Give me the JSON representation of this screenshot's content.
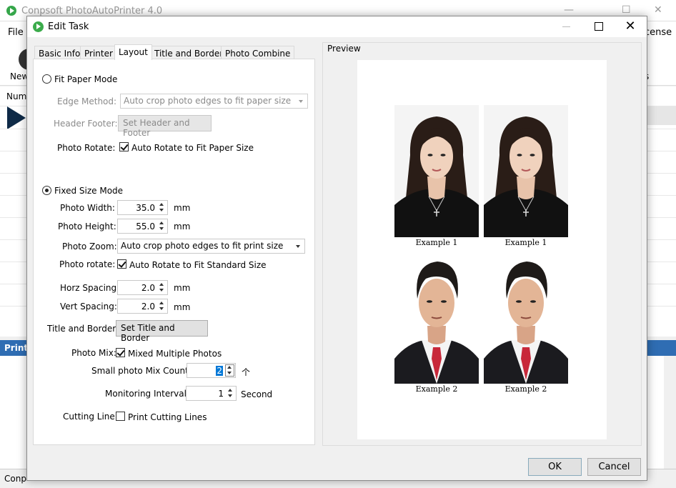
{
  "app": {
    "title": "Conpsoft PhotoAutoPrinter 4.0",
    "menu_file": "File",
    "menu_license": "cense",
    "toolbar_new": "New",
    "toolbar_right": "s",
    "grid_header": "Numb",
    "print_header": "Print",
    "status_text": "Conp"
  },
  "dialog": {
    "title": "Edit Task",
    "tabs": [
      "Basic Info",
      "Printer",
      "Layout",
      "Title and Border",
      "Photo Combine"
    ],
    "active_tab": "Layout",
    "fit_paper_mode": {
      "label": "Fit Paper Mode",
      "selected": false,
      "edge_method_label": "Edge Method:",
      "edge_method_value": "Auto crop photo edges to fit paper size",
      "header_footer_label": "Header Footer:",
      "header_footer_button": "Set Header and Footer",
      "photo_rotate_label": "Photo Rotate:",
      "photo_rotate_check": "Auto Rotate to Fit Paper Size",
      "photo_rotate_checked": true
    },
    "fixed_size_mode": {
      "label": "Fixed Size Mode",
      "selected": true,
      "photo_width_label": "Photo Width:",
      "photo_width_value": "35.0",
      "photo_height_label": "Photo Height:",
      "photo_height_value": "55.0",
      "unit_mm": "mm",
      "photo_zoom_label": "Photo Zoom:",
      "photo_zoom_value": "Auto crop photo edges to fit print size",
      "photo_rotate_label": "Photo rotate:",
      "photo_rotate_check": "Auto Rotate to Fit Standard Size",
      "photo_rotate_checked": true,
      "horz_spacing_label": "Horz Spacing:",
      "horz_spacing_value": "2.0",
      "vert_spacing_label": "Vert Spacing:",
      "vert_spacing_value": "2.0",
      "title_border_label": "Title and Border:",
      "title_border_button": "Set Title and Border",
      "photo_mix_label": "Photo Mix:",
      "photo_mix_check": "Mixed Multiple Photos",
      "photo_mix_checked": true,
      "small_mix_label": "Small photo Mix Count:",
      "small_mix_value": "2",
      "small_mix_unit": "个",
      "monitoring_label": "Monitoring Interval:",
      "monitoring_value": "1",
      "monitoring_unit": "Second",
      "cutting_line_label": "Cutting Line:",
      "cutting_line_check": "Print Cutting Lines",
      "cutting_line_checked": false
    },
    "preview": {
      "label": "Preview",
      "captions": [
        "Example 1",
        "Example 1",
        "Example 2",
        "Example 2"
      ]
    },
    "ok_label": "OK",
    "cancel_label": "Cancel",
    "close_glyph": "✕"
  },
  "colors": {
    "accent_blue": "#2f6db3",
    "logo_green": "#3bab4b",
    "selection_blue": "#0078d7"
  }
}
